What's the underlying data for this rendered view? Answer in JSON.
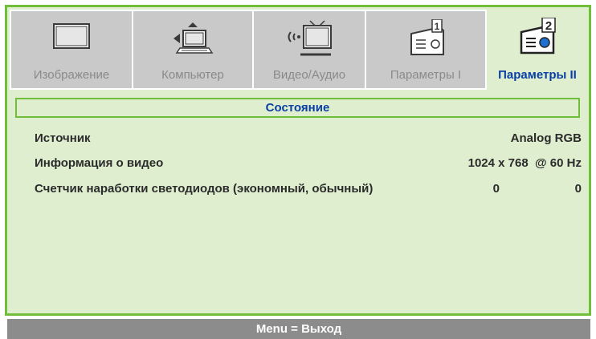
{
  "tabs": [
    {
      "label": "Изображение",
      "icon": "monitor-icon",
      "active": false
    },
    {
      "label": "Компьютер",
      "icon": "computer-icon",
      "active": false
    },
    {
      "label": "Видео/Аудио",
      "icon": "video-audio-icon",
      "active": false
    },
    {
      "label": "Параметры I",
      "icon": "projector-settings-1-icon",
      "active": false
    },
    {
      "label": "Параметры II",
      "icon": "projector-settings-2-icon",
      "active": true
    }
  ],
  "section_title": "Состояние",
  "rows": [
    {
      "name": "Источник",
      "value": "Analog RGB"
    },
    {
      "name": "Информация о видео",
      "value": "1024 x 768  @ 60 Hz"
    },
    {
      "name": "Счетчик наработки светодиодов (экономный, обычный)",
      "value_1": "0",
      "value_2": "0"
    }
  ],
  "footer": "Menu = Выход",
  "colors": {
    "accent_green": "#6fbf3a",
    "panel_bg": "#dfeecf",
    "active_text": "#0a3fa6",
    "inactive_tab": "#c9c9c9",
    "footer_bg": "#8c8c8c"
  }
}
